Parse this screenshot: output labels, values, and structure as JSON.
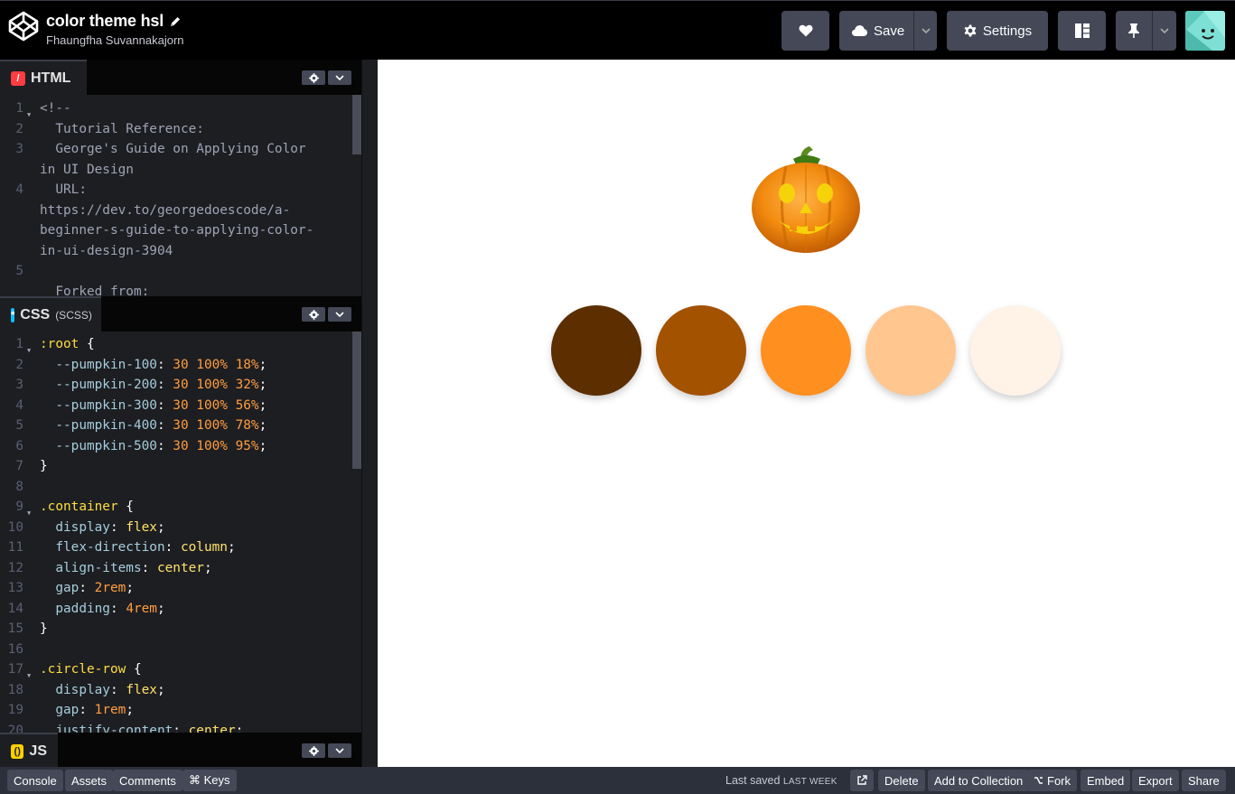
{
  "header": {
    "title": "color theme hsl",
    "author": "Fhaungfha Suvannakajorn",
    "save_label": "Save",
    "settings_label": "Settings"
  },
  "editors": {
    "html": {
      "tab_label": "HTML",
      "lines": [
        {
          "n": "1",
          "fold": true,
          "text": "<!--"
        },
        {
          "n": "2",
          "text": "  Tutorial Reference:"
        },
        {
          "n": "3",
          "text": "  George's Guide on Applying Color"
        },
        {
          "n": "",
          "text": "in UI Design"
        },
        {
          "n": "4",
          "text": "  URL:"
        },
        {
          "n": "",
          "text": "https://dev.to/georgedoescode/a-"
        },
        {
          "n": "",
          "text": "beginner-s-guide-to-applying-color-"
        },
        {
          "n": "",
          "text": "in-ui-design-3904"
        },
        {
          "n": "5",
          "text": ""
        },
        {
          "n": "",
          "text": "  Forked from:"
        }
      ]
    },
    "css": {
      "tab_label": "CSS",
      "tab_sub": "(SCSS)",
      "lines": [
        {
          "n": "1",
          "fold": true,
          "parts": [
            [
              "sel",
              ":root"
            ],
            [
              "punc",
              " {"
            ]
          ]
        },
        {
          "n": "2",
          "parts": [
            [
              "prop",
              "  --pumpkin-100"
            ],
            [
              "punc",
              ": "
            ],
            [
              "num",
              "30 100% 18%"
            ],
            [
              "punc",
              ";"
            ]
          ]
        },
        {
          "n": "3",
          "parts": [
            [
              "prop",
              "  --pumpkin-200"
            ],
            [
              "punc",
              ": "
            ],
            [
              "num",
              "30 100% 32%"
            ],
            [
              "punc",
              ";"
            ]
          ]
        },
        {
          "n": "4",
          "parts": [
            [
              "prop",
              "  --pumpkin-300"
            ],
            [
              "punc",
              ": "
            ],
            [
              "num",
              "30 100% 56%"
            ],
            [
              "punc",
              ";"
            ]
          ]
        },
        {
          "n": "5",
          "parts": [
            [
              "prop",
              "  --pumpkin-400"
            ],
            [
              "punc",
              ": "
            ],
            [
              "num",
              "30 100% 78%"
            ],
            [
              "punc",
              ";"
            ]
          ]
        },
        {
          "n": "6",
          "parts": [
            [
              "prop",
              "  --pumpkin-500"
            ],
            [
              "punc",
              ": "
            ],
            [
              "num",
              "30 100% 95%"
            ],
            [
              "punc",
              ";"
            ]
          ]
        },
        {
          "n": "7",
          "parts": [
            [
              "punc",
              "}"
            ]
          ]
        },
        {
          "n": "8",
          "parts": []
        },
        {
          "n": "9",
          "fold": true,
          "parts": [
            [
              "sel",
              ".container"
            ],
            [
              "punc",
              " {"
            ]
          ]
        },
        {
          "n": "10",
          "parts": [
            [
              "prop",
              "  display"
            ],
            [
              "punc",
              ": "
            ],
            [
              "kw",
              "flex"
            ],
            [
              "punc",
              ";"
            ]
          ]
        },
        {
          "n": "11",
          "parts": [
            [
              "prop",
              "  flex-direction"
            ],
            [
              "punc",
              ": "
            ],
            [
              "kw",
              "column"
            ],
            [
              "punc",
              ";"
            ]
          ]
        },
        {
          "n": "12",
          "parts": [
            [
              "prop",
              "  align-items"
            ],
            [
              "punc",
              ": "
            ],
            [
              "kw",
              "center"
            ],
            [
              "punc",
              ";"
            ]
          ]
        },
        {
          "n": "13",
          "parts": [
            [
              "prop",
              "  gap"
            ],
            [
              "punc",
              ": "
            ],
            [
              "num",
              "2rem"
            ],
            [
              "punc",
              ";"
            ]
          ]
        },
        {
          "n": "14",
          "parts": [
            [
              "prop",
              "  padding"
            ],
            [
              "punc",
              ": "
            ],
            [
              "num",
              "4rem"
            ],
            [
              "punc",
              ";"
            ]
          ]
        },
        {
          "n": "15",
          "parts": [
            [
              "punc",
              "}"
            ]
          ]
        },
        {
          "n": "16",
          "parts": []
        },
        {
          "n": "17",
          "fold": true,
          "parts": [
            [
              "sel",
              ".circle-row"
            ],
            [
              "punc",
              " {"
            ]
          ]
        },
        {
          "n": "18",
          "parts": [
            [
              "prop",
              "  display"
            ],
            [
              "punc",
              ": "
            ],
            [
              "kw",
              "flex"
            ],
            [
              "punc",
              ";"
            ]
          ]
        },
        {
          "n": "19",
          "parts": [
            [
              "prop",
              "  gap"
            ],
            [
              "punc",
              ": "
            ],
            [
              "num",
              "1rem"
            ],
            [
              "punc",
              ";"
            ]
          ]
        },
        {
          "n": "20",
          "parts": [
            [
              "prop",
              "  justify-content"
            ],
            [
              "punc",
              ": "
            ],
            [
              "kw",
              "center"
            ],
            [
              "punc",
              ";"
            ]
          ]
        }
      ]
    },
    "js": {
      "tab_label": "JS"
    }
  },
  "preview": {
    "swatches": [
      "#5c2e00",
      "#a35200",
      "#ff8f1f",
      "#ffc68f",
      "#fff2e6"
    ]
  },
  "footer": {
    "left_buttons": [
      "Console",
      "Assets",
      "Comments",
      "⌘ Keys"
    ],
    "saved_prefix": "Last saved",
    "saved_when": "LAST WEEK",
    "right_buttons": [
      "Delete",
      "Add to Collection",
      "Fork",
      "Embed",
      "Export",
      "Share"
    ]
  },
  "colors": {
    "accent_html": "#ff3c41",
    "accent_css": "#0ebeff",
    "accent_js": "#fcd000"
  }
}
